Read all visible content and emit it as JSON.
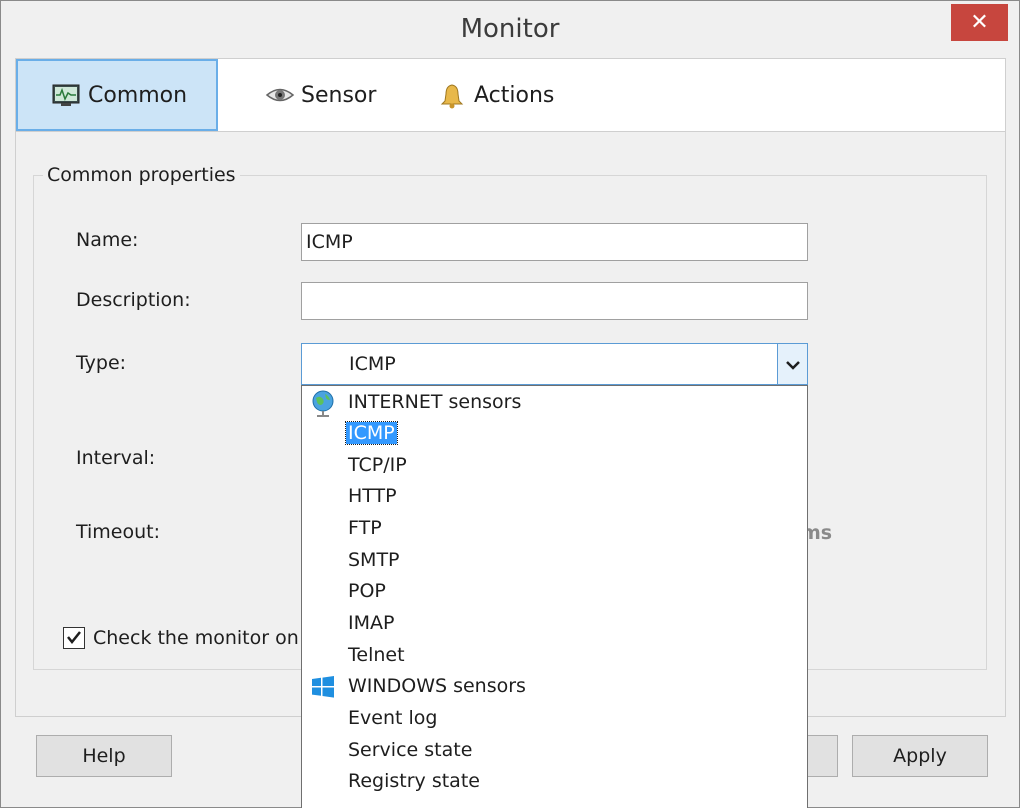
{
  "window": {
    "title": "Monitor",
    "close_glyph": "✕"
  },
  "tabs": [
    {
      "label": "Common",
      "icon": "monitor-chart-icon",
      "active": true
    },
    {
      "label": "Sensor",
      "icon": "eye-icon",
      "active": false
    },
    {
      "label": "Actions",
      "icon": "bell-icon",
      "active": false
    }
  ],
  "group": {
    "title": "Common properties"
  },
  "fields": {
    "name_label": "Name:",
    "name_value": "ICMP",
    "description_label": "Description:",
    "description_value": "",
    "type_label": "Type:",
    "type_value": "ICMP",
    "interval_label": "Interval:",
    "timeout_label": "Timeout:",
    "timeout_unit_partial": "ms"
  },
  "checkbox": {
    "label": "Check the monitor on creation",
    "checked": true,
    "visible_label": "Check the monitor on cr"
  },
  "dropdown": {
    "items": [
      {
        "label": "INTERNET sensors",
        "icon": "globe-icon",
        "selected": false
      },
      {
        "label": "ICMP",
        "selected": true
      },
      {
        "label": "TCP/IP",
        "selected": false
      },
      {
        "label": "HTTP",
        "selected": false
      },
      {
        "label": "FTP",
        "selected": false
      },
      {
        "label": "SMTP",
        "selected": false
      },
      {
        "label": "POP",
        "selected": false
      },
      {
        "label": "IMAP",
        "selected": false
      },
      {
        "label": "Telnet",
        "selected": false
      },
      {
        "label": "WINDOWS sensors",
        "icon": "windows-logo-icon",
        "selected": false
      },
      {
        "label": "Event log",
        "selected": false
      },
      {
        "label": "Service state",
        "selected": false
      },
      {
        "label": "Registry state",
        "selected": false
      }
    ]
  },
  "buttons": {
    "help": "Help",
    "apply": "Apply"
  },
  "colors": {
    "close": "#c7463e",
    "tab_active": "#cce4f7",
    "selection": "#3399ff"
  }
}
